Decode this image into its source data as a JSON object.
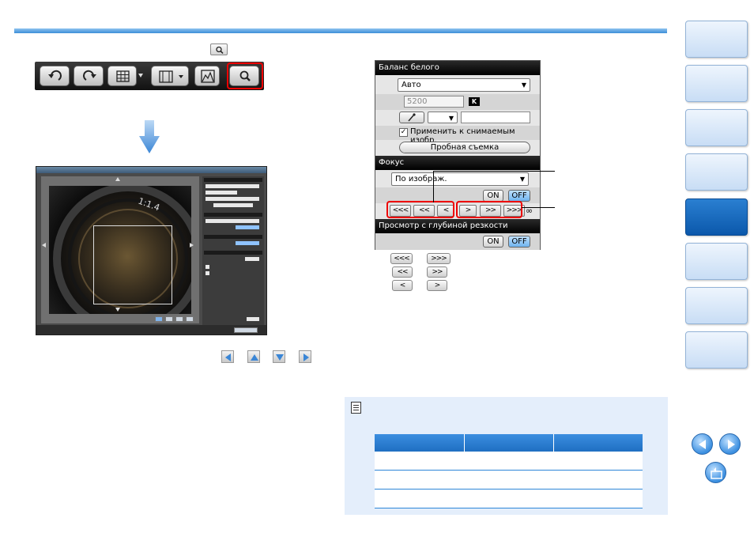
{
  "panel": {
    "wb_header": "Баланс белого",
    "wb_select": "Авто",
    "kelvin_value": "5200",
    "kelvin_badge": "K",
    "apply_label": "Применить к снимаемым изобр.",
    "test_shot_label": "Пробная съемка",
    "focus_header": "Фокус",
    "focus_select": "По изображ.",
    "on_label": "ON",
    "off_label": "OFF",
    "dof_header": "Просмотр с глубиной резкости",
    "focus_buttons": [
      "<<<",
      "<<",
      "<",
      ">",
      ">>",
      ">>>"
    ],
    "infinity": "∞"
  },
  "legend": {
    "left": [
      "<<<",
      "<<",
      "<"
    ],
    "right": [
      ">>>",
      ">>",
      ">"
    ]
  },
  "photo": {
    "lens_text": "1:1.4"
  },
  "colors": {
    "accent_blue": "#1f6fc2",
    "highlight_red": "#e00000",
    "note_bg": "#e4eefb"
  }
}
